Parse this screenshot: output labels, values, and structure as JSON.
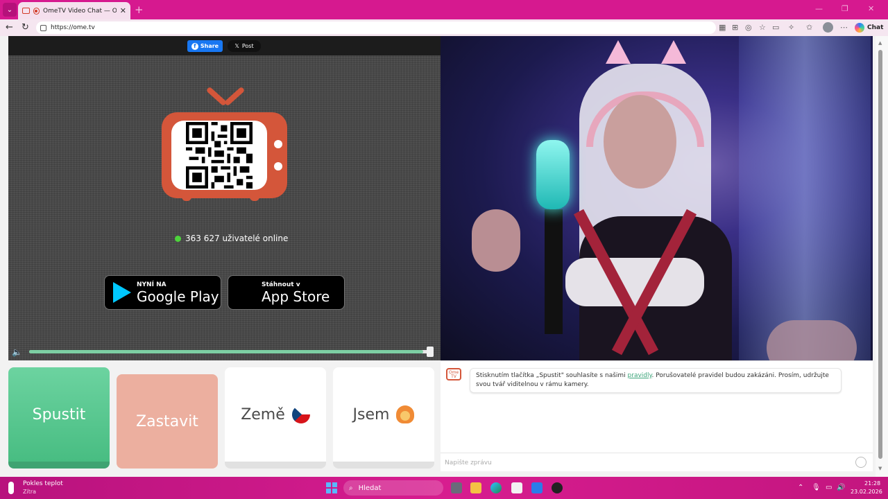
{
  "browser": {
    "tab_title": "OmeTV Video Chat — Omegle",
    "url": "https://ome.tv",
    "chat_label": "Chat"
  },
  "share": {
    "facebook_label": "Share",
    "x_label": "Post"
  },
  "logo": {
    "brand": "OmeTV"
  },
  "online_text": "363 627 uživatelé online",
  "stores": {
    "google": {
      "small": "NYNÍ NA",
      "big": "Google Play"
    },
    "apple": {
      "small": "Stáhnout v",
      "big": "App Store"
    }
  },
  "volume": {
    "level_fraction": 0.98
  },
  "buttons": {
    "start": "Spustit",
    "stop": "Zastavit",
    "country": "Země",
    "iam": "Jsem"
  },
  "chat": {
    "logo_text": "Ome TV",
    "message_before": "Stisknutím tlačítka „Spustit\" souhlasíte s našimi ",
    "message_link": "pravidly",
    "message_after": ". Porušovatelé pravidel budou zakázáni. Prosím, udržujte svou tvář viditelnou v rámu kamery.",
    "input_placeholder": "Napište zprávu"
  },
  "taskbar": {
    "weather_title": "Pokles teplot",
    "weather_sub": "Zítra",
    "search_placeholder": "Hledat",
    "time": "21:28",
    "date": "23.02.2026"
  },
  "colors": {
    "accent_green": "#48bd82",
    "stop_salmon": "#ecaf9f",
    "logo_orange": "#d4563a",
    "browser_frame": "#d6198f"
  }
}
